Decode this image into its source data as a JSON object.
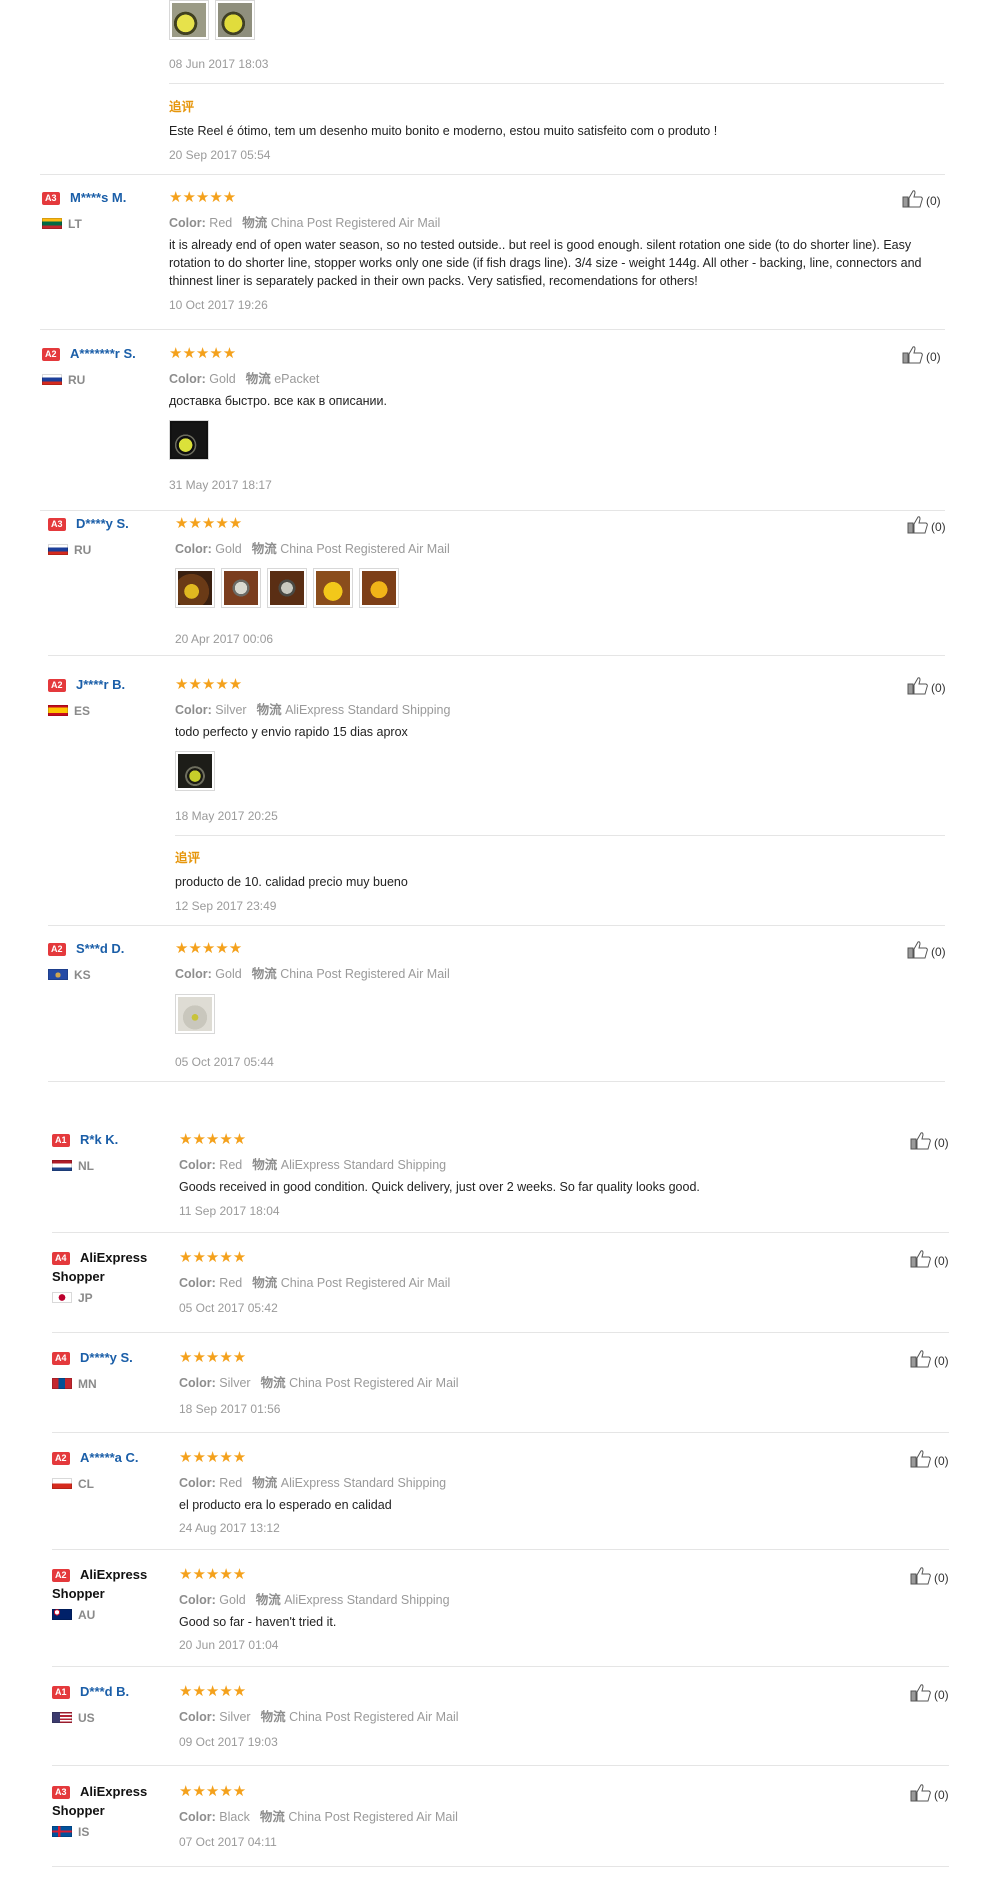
{
  "common": {
    "color_label": "Color:",
    "ship_label": "物流",
    "append_label": "追评",
    "star_glyph": "★★★★★",
    "star_color": "#f4a11c",
    "badge_color": "#e4393c",
    "name_color": "#1a5ea8",
    "append_color": "#e6960c"
  },
  "top": {
    "thumbs": [
      "photo",
      "photo"
    ],
    "date": "08 Jun 2017 18:03",
    "append_text": "Este Reel é ótimo, tem um desenho muito bonito e moderno, estou muito satisfeito com o produto !",
    "append_date": "20 Sep 2017 05:54"
  },
  "reviews": [
    {
      "level": "A3",
      "name": "M****s M.",
      "country": "LT",
      "rating": 5,
      "color": "Red",
      "shipping": "China Post Registered Air Mail",
      "text": "it is already end of open water season, so no tested outside.. but reel is good enough. silent rotation one side (to do shorter line). Easy rotation to do shorter line, stopper works only one side (if fish drags line). 3/4 size - weight 144g. All other - backing, line, connectors and thinnest liner is separately packed in their own packs. Very satisfied, recomendations for others!",
      "date": "10 Oct 2017 19:26",
      "likes": "(0)"
    },
    {
      "level": "A2",
      "name": "A*******r S.",
      "country": "RU",
      "rating": 5,
      "color": "Gold",
      "shipping": "ePacket",
      "text": "доставка быстро. все как в описании.",
      "thumbs": [
        "photo"
      ],
      "date": "31 May 2017 18:17",
      "likes": "(0)"
    },
    {
      "level": "A3",
      "name": "D****y S.",
      "country": "RU",
      "rating": 5,
      "color": "Gold",
      "shipping": "China Post Registered Air Mail",
      "thumbs": [
        "photo",
        "photo",
        "photo",
        "photo",
        "photo"
      ],
      "date": "20 Apr 2017 00:06",
      "likes": "(0)"
    },
    {
      "level": "A2",
      "name": "J****r B.",
      "country": "ES",
      "rating": 5,
      "color": "Silver",
      "shipping": "AliExpress Standard Shipping",
      "text": "todo perfecto y envio rapido 15 dias aprox",
      "thumbs": [
        "photo"
      ],
      "date": "18 May 2017 20:25",
      "append_text": "producto de 10. calidad precio muy bueno",
      "append_date": "12 Sep 2017 23:49",
      "likes": "(0)"
    },
    {
      "level": "A2",
      "name": "S***d D.",
      "country": "KS",
      "rating": 5,
      "color": "Gold",
      "shipping": "China Post Registered Air Mail",
      "thumbs": [
        "photo"
      ],
      "date": "05 Oct 2017 05:44",
      "likes": "(0)"
    },
    {
      "level": "A1",
      "name": "R*k K.",
      "country": "NL",
      "rating": 5,
      "color": "Red",
      "shipping": "AliExpress Standard Shipping",
      "text": "Goods received in good condition. Quick delivery, just over 2 weeks. So far quality looks good.",
      "date": "11 Sep 2017 18:04",
      "likes": "(0)"
    },
    {
      "level": "A4",
      "name": "AliExpress Shopper",
      "country": "JP",
      "rating": 5,
      "color": "Red",
      "shipping": "China Post Registered Air Mail",
      "date": "05 Oct 2017 05:42",
      "likes": "(0)"
    },
    {
      "level": "A4",
      "name": "D****y S.",
      "country": "MN",
      "rating": 5,
      "color": "Silver",
      "shipping": "China Post Registered Air Mail",
      "date": "18 Sep 2017 01:56",
      "likes": "(0)"
    },
    {
      "level": "A2",
      "name": "A*****a C.",
      "country": "CL",
      "rating": 5,
      "color": "Red",
      "shipping": "AliExpress Standard Shipping",
      "text": "el producto era lo esperado en calidad",
      "date": "24 Aug 2017 13:12",
      "likes": "(0)"
    },
    {
      "level": "A2",
      "name": "AliExpress Shopper",
      "country": "AU",
      "rating": 5,
      "color": "Gold",
      "shipping": "AliExpress Standard Shipping",
      "text": "Good so far - haven't tried it.",
      "date": "20 Jun 2017 01:04",
      "likes": "(0)"
    },
    {
      "level": "A1",
      "name": "D***d B.",
      "country": "US",
      "rating": 5,
      "color": "Silver",
      "shipping": "China Post Registered Air Mail",
      "date": "09 Oct 2017 19:03",
      "likes": "(0)"
    },
    {
      "level": "A3",
      "name": "AliExpress Shopper",
      "country": "IS",
      "rating": 5,
      "color": "Black",
      "shipping": "China Post Registered Air Mail",
      "date": "07 Oct 2017 04:11",
      "likes": "(0)"
    }
  ]
}
